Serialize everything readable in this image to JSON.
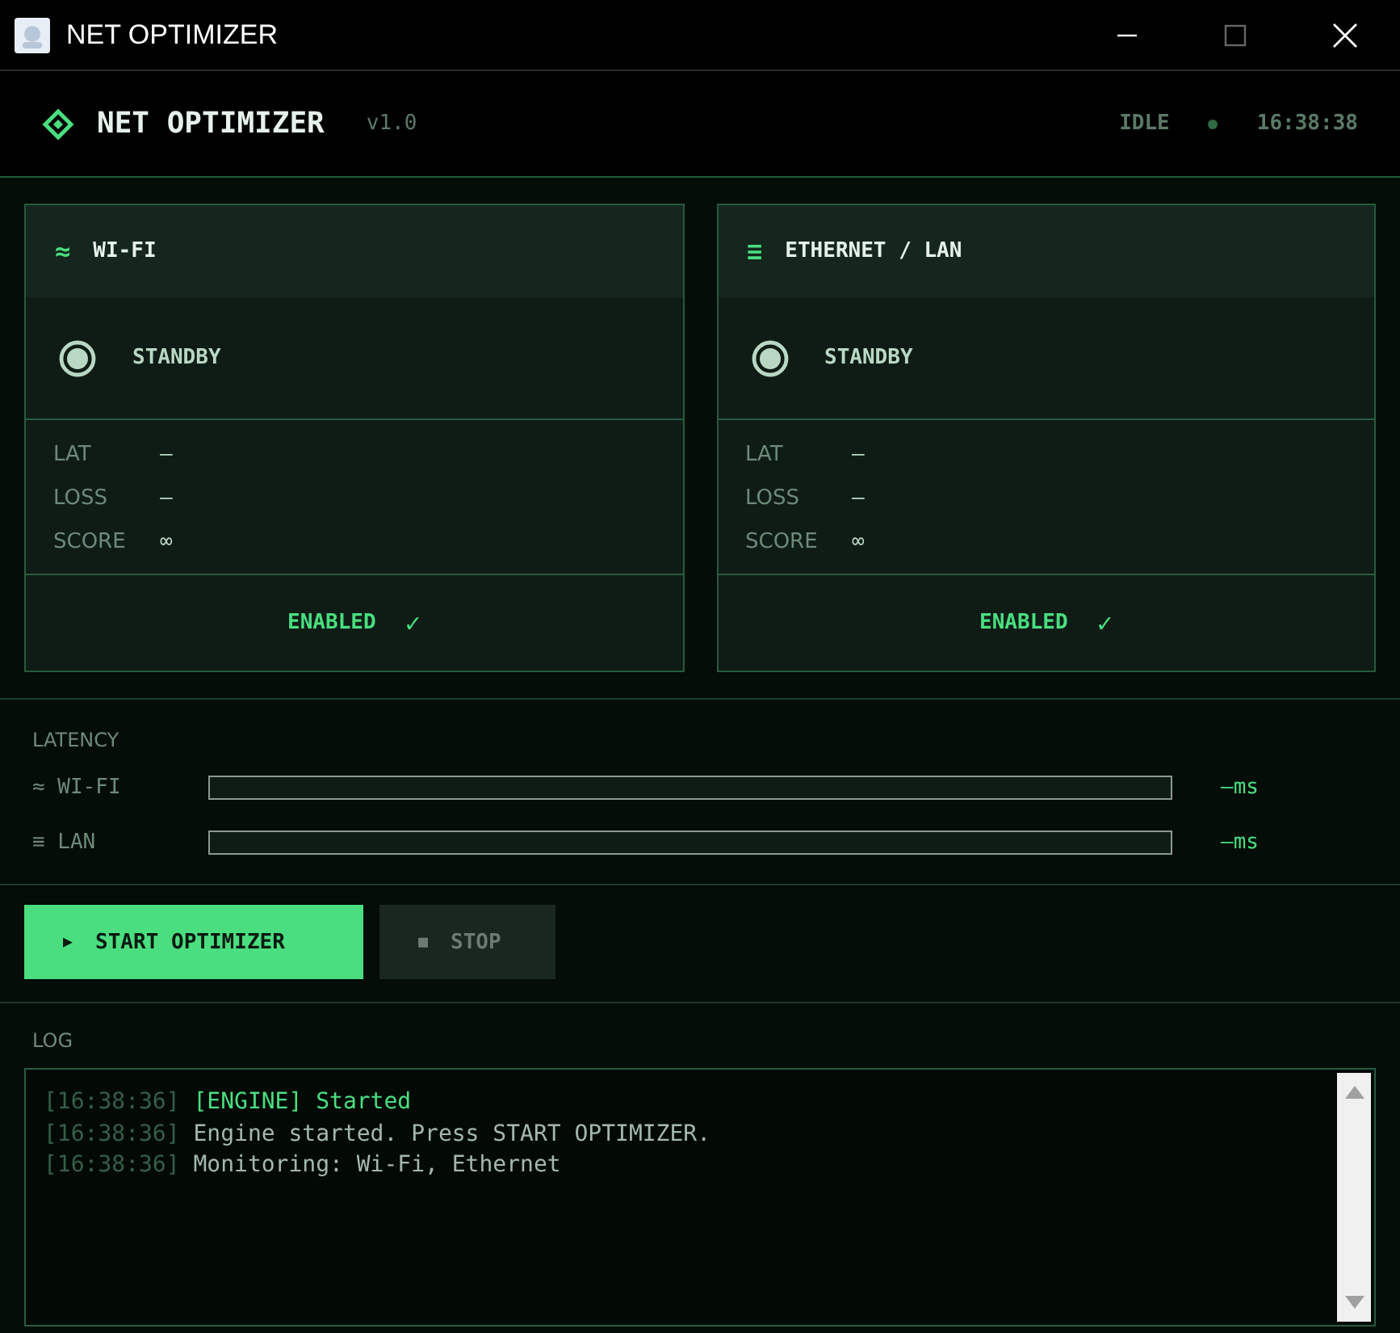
{
  "window": {
    "title": "NET OPTIMIZER"
  },
  "header": {
    "title": "NET OPTIMIZER",
    "version": "v1.0",
    "status": "IDLE",
    "time": "16:38:38"
  },
  "adapters": [
    {
      "icon": "≈",
      "name": "WI-FI",
      "state": "STANDBY",
      "stats": [
        {
          "label": "LAT",
          "value": "—"
        },
        {
          "label": "LOSS",
          "value": "—"
        },
        {
          "label": "SCORE",
          "value": "∞"
        }
      ],
      "enabled": true,
      "toggle_label": "ENABLED",
      "toggle_mark": "✓"
    },
    {
      "icon": "≡",
      "name": "ETHERNET / LAN",
      "state": "STANDBY",
      "stats": [
        {
          "label": "LAT",
          "value": "—"
        },
        {
          "label": "LOSS",
          "value": "—"
        },
        {
          "label": "SCORE",
          "value": "∞"
        }
      ],
      "enabled": true,
      "toggle_label": "ENABLED",
      "toggle_mark": "✓"
    }
  ],
  "latency": {
    "title": "LATENCY",
    "rows": [
      {
        "icon": "≈",
        "label": "WI-FI",
        "level": 0,
        "reading": "—ms"
      },
      {
        "icon": "≡",
        "label": "LAN",
        "level": 0,
        "reading": "—ms"
      }
    ]
  },
  "buttons": [
    {
      "kind": "start",
      "icon": "▶",
      "label": "START OPTIMIZER",
      "disabled": false
    },
    {
      "kind": "stop",
      "icon": "■",
      "label": "STOP",
      "disabled": true
    }
  ],
  "log": {
    "title": "LOG",
    "lines": [
      {
        "kind": "event",
        "time": "[16:38:36]",
        "text": "[ENGINE] Started"
      },
      {
        "kind": "info",
        "time": "[16:38:36]",
        "text": "Engine started. Press START OPTIMIZER."
      },
      {
        "kind": "info",
        "time": "[16:38:36]",
        "text": "Monitoring: Wi-Fi, Ethernet"
      }
    ]
  }
}
